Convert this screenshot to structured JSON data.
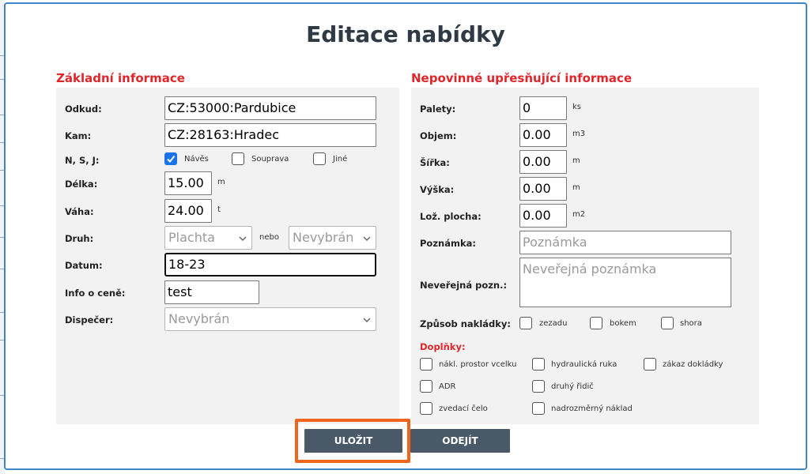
{
  "title": "Editace nabídky",
  "left_section": {
    "title": "Základní informace",
    "odkud": {
      "label": "Odkud:",
      "value": "CZ:53000:Pardubice"
    },
    "kam": {
      "label": "Kam:",
      "value": "CZ:28163:Hradec"
    },
    "nsj": {
      "label": "N, S, J:",
      "options": [
        {
          "label": "Návěs",
          "checked": true
        },
        {
          "label": "Souprava",
          "checked": false
        },
        {
          "label": "Jiné",
          "checked": false
        }
      ]
    },
    "delka": {
      "label": "Délka:",
      "value": "15.00",
      "unit": "m"
    },
    "vaha": {
      "label": "Váha:",
      "value": "24.00",
      "unit": "t"
    },
    "druh": {
      "label": "Druh:",
      "select1": "Plachta",
      "connector": "nebo",
      "select2": "Nevybrán"
    },
    "datum": {
      "label": "Datum:",
      "value": "18-23"
    },
    "info": {
      "label": "Info o ceně:",
      "value": "test"
    },
    "dispecer": {
      "label": "Dispečer:",
      "value": "Nevybrán"
    }
  },
  "right_section": {
    "title": "Nepovinné upřesňující informace",
    "palety": {
      "label": "Palety:",
      "value": "0",
      "unit": "ks"
    },
    "objem": {
      "label": "Objem:",
      "value": "0.00",
      "unit": "m3"
    },
    "sirka": {
      "label": "Šířka:",
      "value": "0.00",
      "unit": "m"
    },
    "vyska": {
      "label": "Výška:",
      "value": "0.00",
      "unit": "m"
    },
    "loz": {
      "label": "Lož. plocha:",
      "value": "0.00",
      "unit": "m2"
    },
    "poznamka": {
      "label": "Poznámka:",
      "placeholder": "Poznámka"
    },
    "neverejna": {
      "label": "Neveřejná pozn.:",
      "placeholder": "Neveřejná poznámka"
    },
    "nakladky": {
      "label": "Způsob nakládky:",
      "options": [
        {
          "label": "zezadu",
          "checked": false
        },
        {
          "label": "bokem",
          "checked": false
        },
        {
          "label": "shora",
          "checked": false
        }
      ]
    },
    "doplnky": {
      "label": "Doplňky:",
      "options": [
        {
          "label": "nákl. prostor vcelku",
          "checked": false
        },
        {
          "label": "hydraulická ruka",
          "checked": false
        },
        {
          "label": "zákaz dokládky",
          "checked": false
        },
        {
          "label": "ADR",
          "checked": false
        },
        {
          "label": "druhý řidič",
          "checked": false
        },
        {
          "label": "zvedací čelo",
          "checked": false
        },
        {
          "label": "nadrozměrný náklad",
          "checked": false
        }
      ]
    }
  },
  "buttons": {
    "save": "ULOŽIT",
    "leave": "ODEJÍT"
  },
  "colors": {
    "accent_red": "#e0262b",
    "button": "#4a5967",
    "highlight": "#f0641e",
    "modal_border": "#3f86c9",
    "checkbox_checked": "#1a73e8"
  }
}
